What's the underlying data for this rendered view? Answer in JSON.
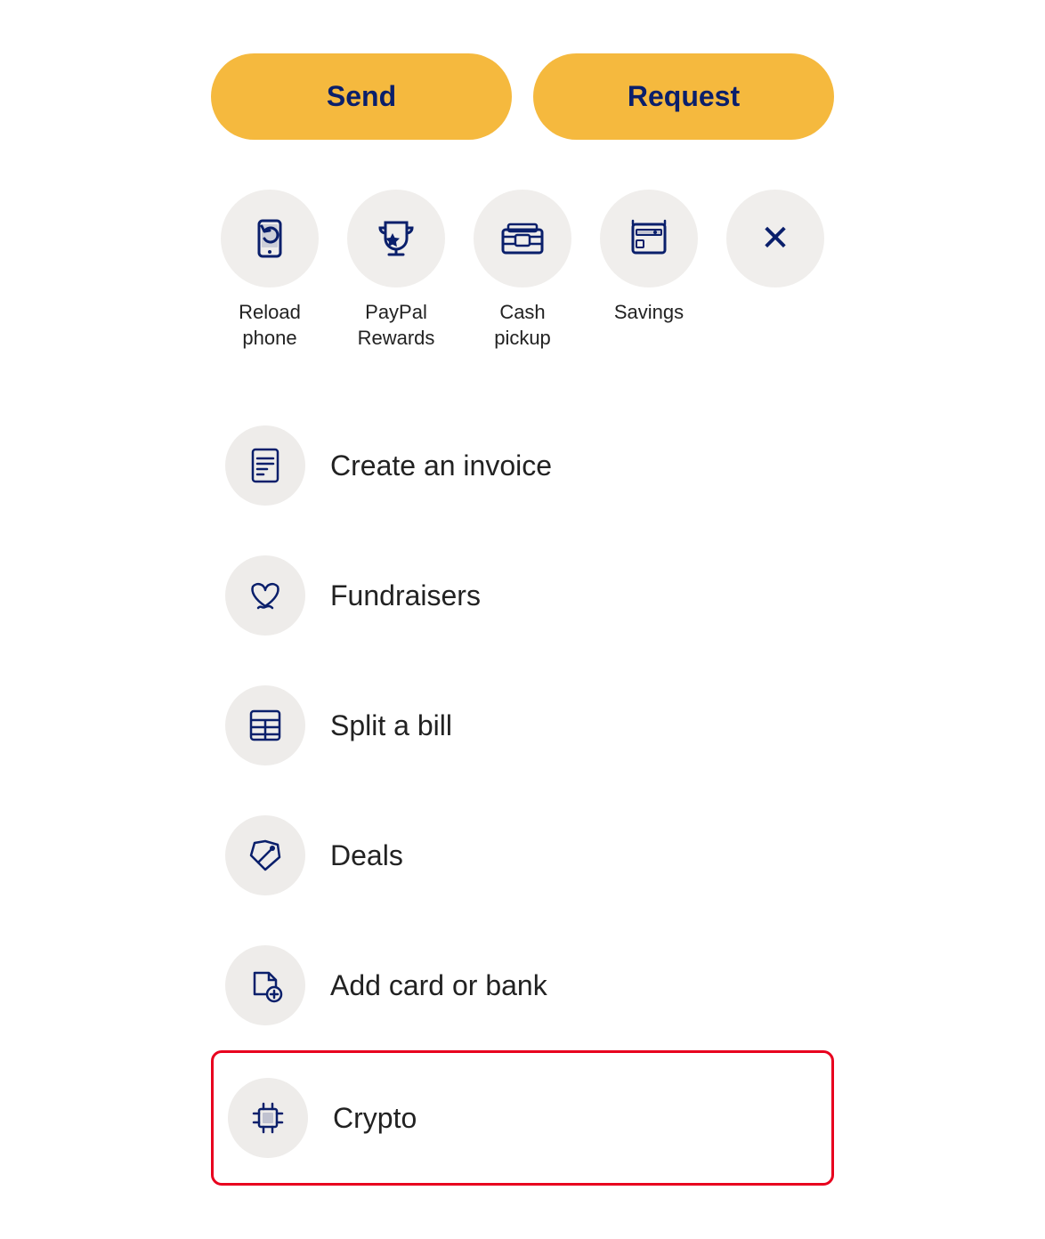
{
  "action_buttons": {
    "send": "Send",
    "request": "Request"
  },
  "quick_actions": [
    {
      "id": "reload-phone",
      "label": "Reload\nphone",
      "icon": "reload-phone-icon"
    },
    {
      "id": "paypal-rewards",
      "label": "PayPal\nRewards",
      "icon": "trophy-icon"
    },
    {
      "id": "cash-pickup",
      "label": "Cash\npickup",
      "icon": "cash-pickup-icon"
    },
    {
      "id": "savings",
      "label": "Savings",
      "icon": "savings-icon"
    },
    {
      "id": "close",
      "label": "",
      "icon": "close-icon"
    }
  ],
  "list_items": [
    {
      "id": "create-invoice",
      "label": "Create an invoice",
      "icon": "invoice-icon",
      "highlighted": false
    },
    {
      "id": "fundraisers",
      "label": "Fundraisers",
      "icon": "fundraisers-icon",
      "highlighted": false
    },
    {
      "id": "split-bill",
      "label": "Split a bill",
      "icon": "split-bill-icon",
      "highlighted": false
    },
    {
      "id": "deals",
      "label": "Deals",
      "icon": "deals-icon",
      "highlighted": false
    },
    {
      "id": "add-card-bank",
      "label": "Add card or bank",
      "icon": "add-card-icon",
      "highlighted": false
    },
    {
      "id": "crypto",
      "label": "Crypto",
      "icon": "crypto-icon",
      "highlighted": true
    }
  ],
  "colors": {
    "brand_yellow": "#F5B93E",
    "brand_navy": "#0a1f6b",
    "icon_bg": "#eeecea",
    "highlight_border": "#e8001e"
  }
}
